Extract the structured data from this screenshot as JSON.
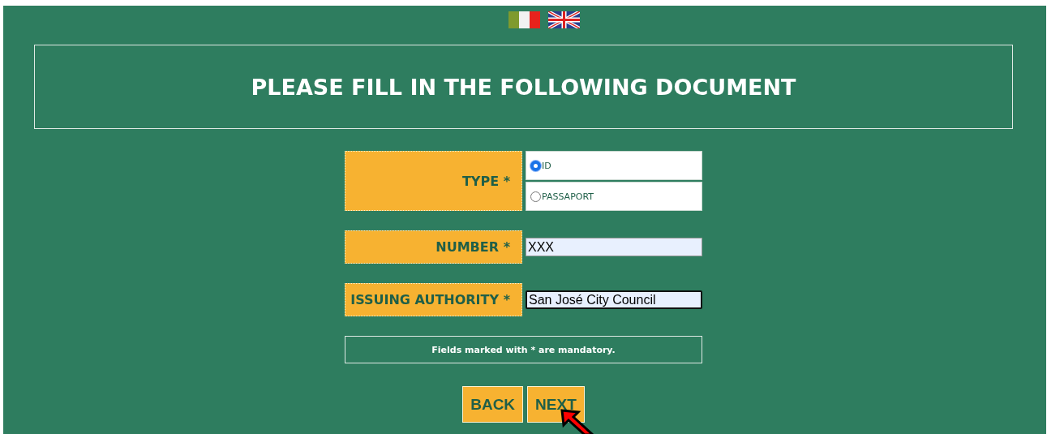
{
  "language_flags": [
    {
      "kind": "italy"
    },
    {
      "kind": "uk"
    }
  ],
  "header": {
    "title": "PLEASE FILL IN THE FOLLOWING DOCUMENT"
  },
  "form": {
    "type": {
      "label": "TYPE *",
      "options": [
        {
          "label": "ID",
          "selected": true
        },
        {
          "label": "PASSAPORT",
          "selected": false
        }
      ]
    },
    "fields": [
      {
        "label": "NUMBER *",
        "value": "XXX",
        "focused": false
      },
      {
        "label": "ISSUING AUTHORITY *",
        "value": "San José City Council",
        "focused": true
      }
    ],
    "note": "Fields marked with * are mandatory."
  },
  "buttons": [
    "BACK",
    "NEXT"
  ],
  "cursor": {
    "visible": true
  }
}
